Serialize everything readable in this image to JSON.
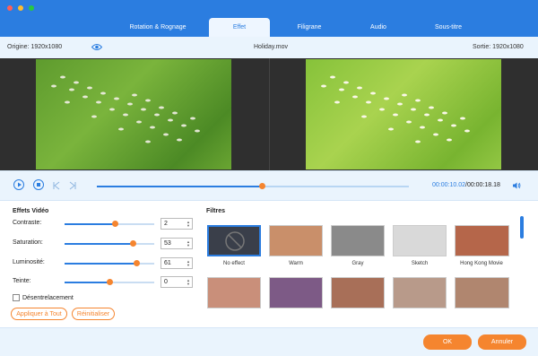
{
  "tabs": [
    {
      "label": "Rotation & Rognage",
      "active": false
    },
    {
      "label": "Effet",
      "active": true
    },
    {
      "label": "Filigrane",
      "active": false
    },
    {
      "label": "Audio",
      "active": false
    },
    {
      "label": "Sous-titre",
      "active": false
    }
  ],
  "info": {
    "origin": "Origine: 1920x1080",
    "filename": "Holiday.mov",
    "output": "Sortie: 1920x1080"
  },
  "player": {
    "current": "00:00:10.02",
    "separator": "/",
    "total": "00:00:18.18",
    "progress": 0.53
  },
  "effects": {
    "title": "Effets Vidéo",
    "params": [
      {
        "label": "Contraste:",
        "value": "2",
        "level": 0.56
      },
      {
        "label": "Saturation:",
        "value": "53",
        "level": 0.76
      },
      {
        "label": "Luminosité:",
        "value": "61",
        "level": 0.8
      },
      {
        "label": "Teinte:",
        "value": "0",
        "level": 0.5
      }
    ],
    "deinterlace": "Désentrelacement",
    "apply_all": "Appliquer à Tout",
    "reset": "Réinitialiser"
  },
  "filters": {
    "title": "Filtres",
    "items": [
      {
        "label": "No effect",
        "color": "#3a3f4a"
      },
      {
        "label": "Warm",
        "color": "#c98f6a"
      },
      {
        "label": "Gray",
        "color": "#8a8a8a"
      },
      {
        "label": "Sketch",
        "color": "#d9d9d9"
      },
      {
        "label": "Hong Kong Movie",
        "color": "#b5664a"
      }
    ],
    "row2_colors": [
      "#c98f7a",
      "#7d5a86",
      "#a86f58",
      "#b89a8a",
      "#b0866f"
    ]
  },
  "buttons": {
    "ok": "OK",
    "cancel": "Annuler"
  },
  "colors": {
    "accent": "#2b7de0",
    "orange": "#f5852f"
  }
}
